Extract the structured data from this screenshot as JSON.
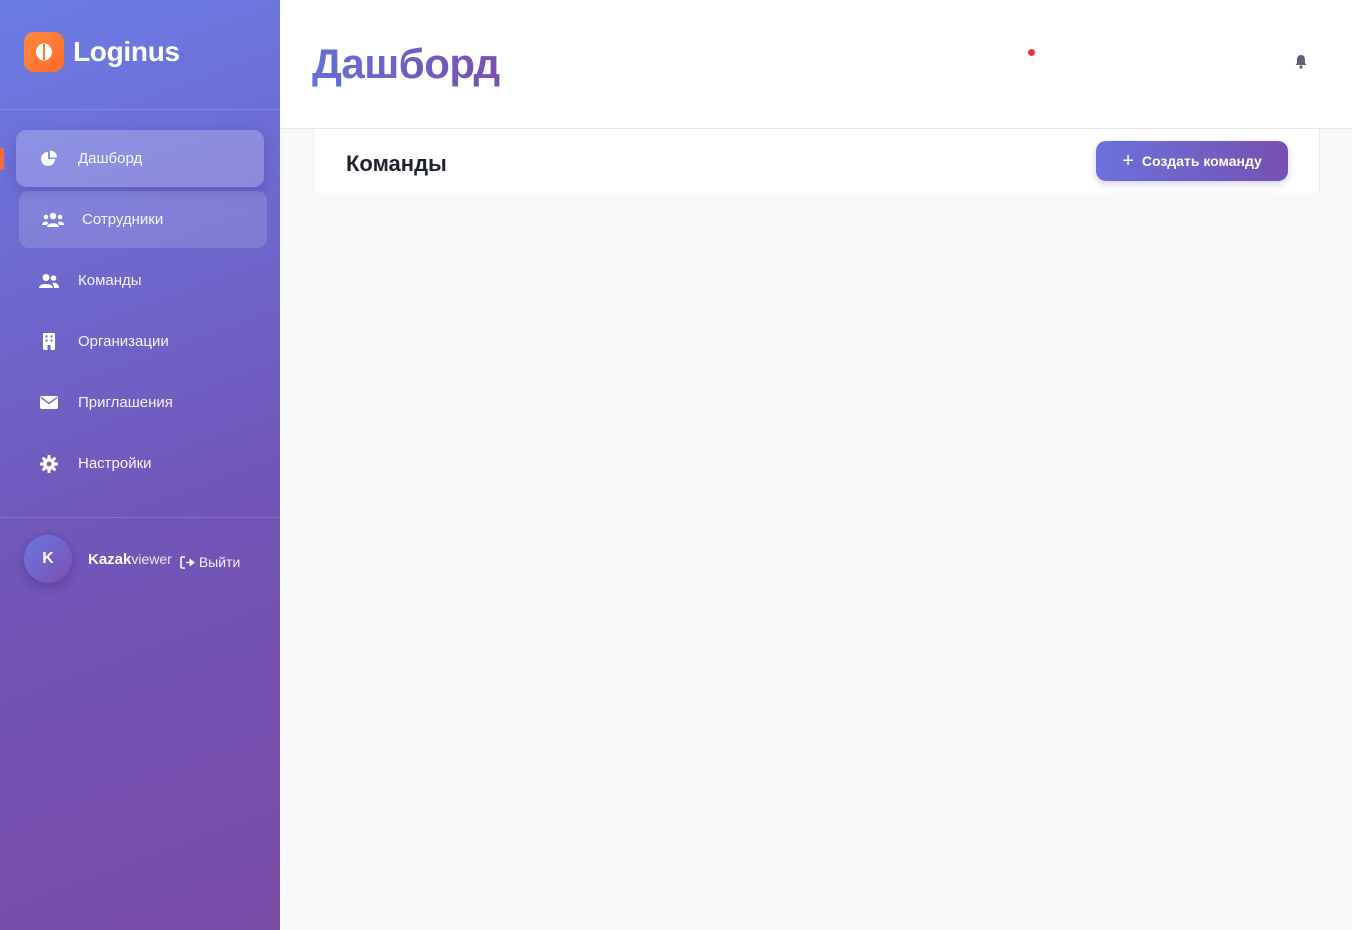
{
  "brand": {
    "name": "Loginus"
  },
  "sidebar": {
    "items": [
      {
        "label": "Дашборд",
        "icon": "pie-chart-icon",
        "state": "active"
      },
      {
        "label": "Сотрудники",
        "icon": "users-icon",
        "state": "hover"
      },
      {
        "label": "Команды",
        "icon": "user-group-icon",
        "state": "normal"
      },
      {
        "label": "Организации",
        "icon": "building-icon",
        "state": "normal"
      },
      {
        "label": "Приглашения",
        "icon": "envelope-icon",
        "state": "normal"
      },
      {
        "label": "Настройки",
        "icon": "gear-icon",
        "state": "normal"
      }
    ]
  },
  "user": {
    "initial": "K",
    "name": "Kazak",
    "role": "viewer",
    "logout_label": "Выйти"
  },
  "header": {
    "title": "Дашборд"
  },
  "teams": {
    "title": "Команды",
    "create_label": "Создать команду"
  },
  "colors": {
    "accent": "#6a72dc",
    "accent_end": "#7750b0",
    "notification_dot": "#e53935",
    "logo": "#ff7a33"
  }
}
